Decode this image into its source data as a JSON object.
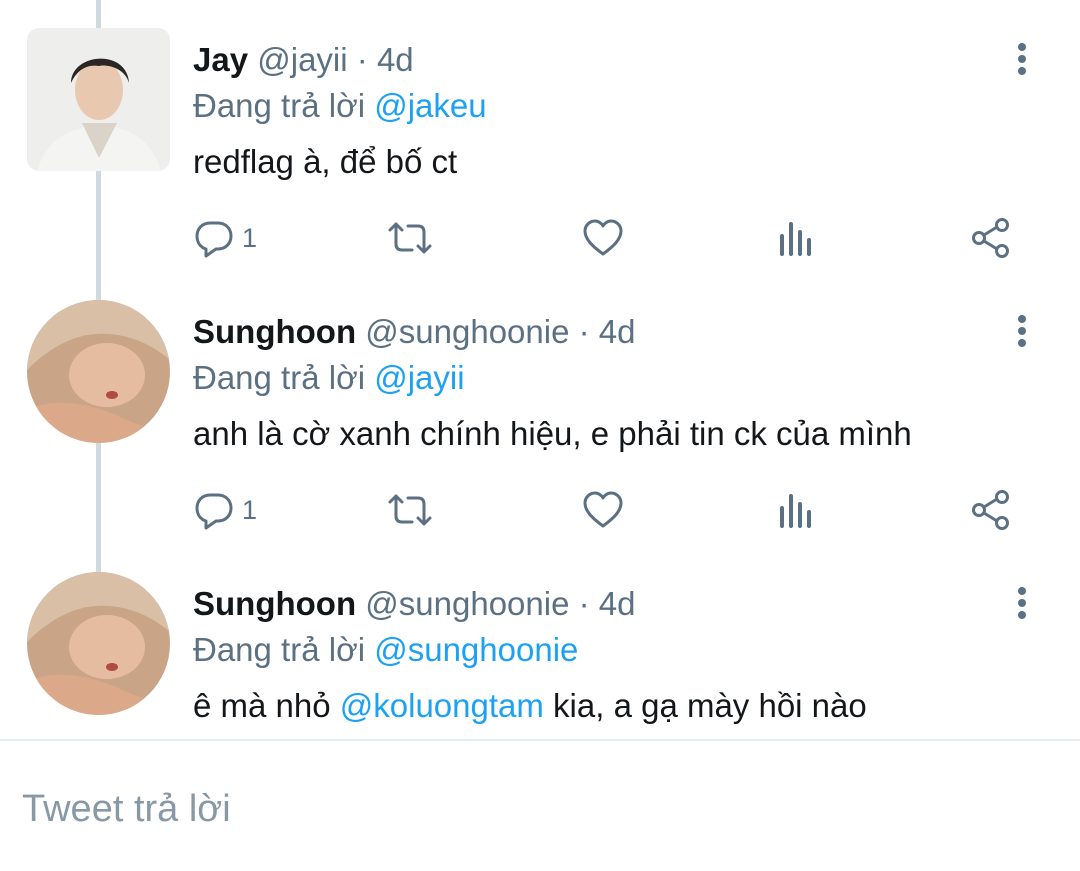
{
  "tweets": [
    {
      "name": "Jay",
      "handle": "@jayii",
      "separator": "·",
      "time": "4d",
      "replying_prefix": "Đang trả lời ",
      "replying_to": "@jakeu",
      "text_before": "redflag à, để bố ct",
      "mention": "",
      "text_after": "",
      "reply_count": "1",
      "avatar_icon": "avatar-jay"
    },
    {
      "name": "Sunghoon",
      "handle": "@sunghoonie",
      "separator": "·",
      "time": "4d",
      "replying_prefix": "Đang trả lời ",
      "replying_to": "@jayii",
      "text_before": "anh là cờ xanh chính hiệu, e phải tin ck của mình",
      "mention": "",
      "text_after": "",
      "reply_count": "1",
      "avatar_icon": "avatar-sunghoon"
    },
    {
      "name": "Sunghoon",
      "handle": "@sunghoonie",
      "separator": "·",
      "time": "4d",
      "replying_prefix": "Đang trả lời ",
      "replying_to": "@sunghoonie",
      "text_before": "ê mà nhỏ ",
      "mention": "@koluongtam",
      "text_after": " kia, a gạ mày hồi nào",
      "avatar_icon": "avatar-sunghoon"
    }
  ],
  "composer": {
    "placeholder": "Tweet trả lời"
  },
  "colors": {
    "accent": "#1da1f2",
    "muted": "#5b7083",
    "thread_line": "#cfd9de"
  },
  "icons": [
    "reply-icon",
    "retweet-icon",
    "like-icon",
    "analytics-icon",
    "share-icon",
    "more-icon"
  ]
}
